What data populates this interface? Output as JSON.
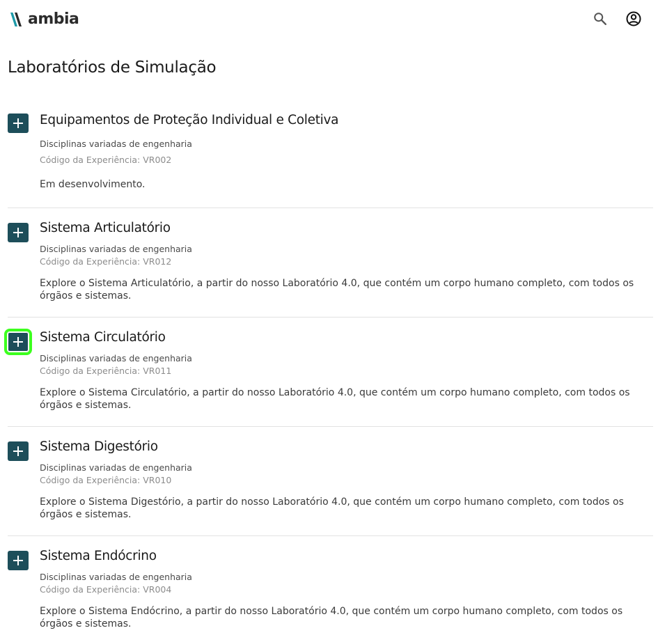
{
  "header": {
    "logo_text": "ambia",
    "search_icon": "search-icon",
    "account_icon": "account-circle-icon"
  },
  "page": {
    "title": "Laboratórios de Simulação"
  },
  "experiences": [
    {
      "title": "Equipamentos de Proteção Individual e Coletiva",
      "area": "Disciplinas variadas de engenharia",
      "code": "Código da Experiência: VR002",
      "description": "Em desenvolvimento."
    },
    {
      "title": "Sistema Articulatório",
      "area": "Disciplinas variadas de engenharia",
      "code": "Código da Experiência: VR012",
      "description": "Explore o Sistema Articulatório, a partir do nosso Laboratório 4.0, que contém um corpo humano completo, com todos os órgãos e sistemas."
    },
    {
      "title": "Sistema Circulatório",
      "area": "Disciplinas variadas de engenharia",
      "code": "Código da Experiência: VR011",
      "description": "Explore o Sistema Circulatório, a partir do nosso Laboratório 4.0, que contém um corpo humano completo, com todos os órgãos e sistemas."
    },
    {
      "title": "Sistema Digestório",
      "area": "Disciplinas variadas de engenharia",
      "code": "Código da Experiência: VR010",
      "description": "Explore o Sistema Digestório, a partir do nosso Laboratório 4.0, que contém um corpo humano completo, com todos os órgãos e sistemas."
    },
    {
      "title": "Sistema Endócrino",
      "area": "Disciplinas variadas de engenharia",
      "code": "Código da Experiência: VR004",
      "description": "Explore o Sistema Endócrino, a partir do nosso Laboratório 4.0, que contém um corpo humano completo, com todos os órgãos e sistemas."
    }
  ],
  "colors": {
    "accent": "#1d4e5a",
    "focus_outline": "#3cff1e",
    "logo_teal": "#1e9aa8"
  }
}
